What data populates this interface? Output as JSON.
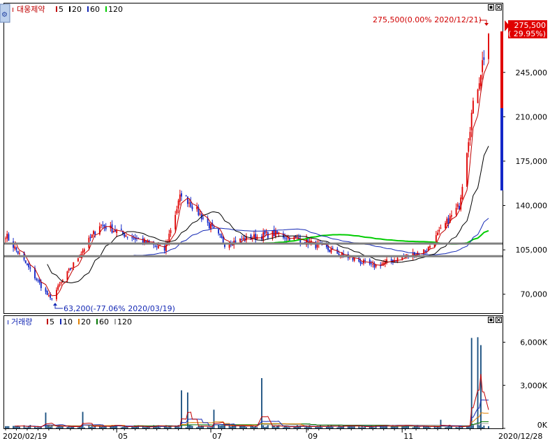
{
  "colors": {
    "up": "#e00000",
    "down": "#1428c8",
    "ma5": "#c00000",
    "ma20": "#000000",
    "ma60": "#1428b4",
    "ma120": "#00cc00",
    "vol_ma5": "#c00000",
    "vol_ma10": "#1428b4",
    "vol_ma20": "#e08000",
    "vol_ma60": "#007700",
    "vol_ma120": "#a0a0a0",
    "hline": "#808080",
    "axis": "#000000"
  },
  "price_panel": {
    "corner_icon": "chart-settings-icon",
    "stock_name": "대웅제약",
    "legend": [
      {
        "label": "5",
        "color": "#c00000"
      },
      {
        "label": "20",
        "color": "#000000"
      },
      {
        "label": "60",
        "color": "#1428b4"
      },
      {
        "label": "120",
        "color": "#00cc00"
      }
    ],
    "high_annotation": "275,500(0.00% 2020/12/21)",
    "low_annotation": "63,200(-77.06% 2020/03/19)",
    "last_price_tag": "275,500",
    "last_change_tag": "( 29.95%)"
  },
  "volume_panel": {
    "title": "거래량",
    "legend": [
      {
        "label": "5",
        "color": "#c00000"
      },
      {
        "label": "10",
        "color": "#1428b4"
      },
      {
        "label": "20",
        "color": "#e08000"
      },
      {
        "label": "60",
        "color": "#007700"
      },
      {
        "label": "120",
        "color": "#a0a0a0"
      }
    ]
  },
  "x_axis": {
    "start_label": "2020/02/19",
    "end_label": "2020/12/28",
    "month_labels": [
      "05",
      "07",
      "09",
      "11"
    ]
  },
  "chart_data": [
    {
      "type": "candlestick",
      "title": "대웅제약",
      "x_range": [
        "2020/02/19",
        "2020/12/28"
      ],
      "y_ticks": [
        70000,
        105000,
        140000,
        175000,
        210000,
        245000
      ],
      "y_tick_labels": [
        "70,000",
        "105,000",
        "140,000",
        "175,000",
        "210,000",
        "245,000"
      ],
      "ylim": [
        55000,
        290000
      ],
      "price_anchor_points": [
        {
          "date": "2020/02/19",
          "close": 117000
        },
        {
          "date": "2020/03/19",
          "close": 66000
        },
        {
          "date": "2020/04/20",
          "close": 125000
        },
        {
          "date": "2020/06/01",
          "close": 105000
        },
        {
          "date": "2020/06/12",
          "close": 150000
        },
        {
          "date": "2020/07/10",
          "close": 110000
        },
        {
          "date": "2020/08/10",
          "close": 118000
        },
        {
          "date": "2020/08/31",
          "close": 112000
        },
        {
          "date": "2020/10/14",
          "close": 92000
        },
        {
          "date": "2020/11/18",
          "close": 105000
        },
        {
          "date": "2020/12/09",
          "close": 140000
        },
        {
          "date": "2020/12/17",
          "close": 212000
        },
        {
          "date": "2020/12/28",
          "close": 275500
        }
      ],
      "highest": {
        "price": 275500,
        "change": "0.00%",
        "date": "2020/12/21"
      },
      "lowest": {
        "price": 63200,
        "change": "-77.06%",
        "date": "2020/03/19"
      },
      "last": {
        "price": 275500,
        "change": "29.95%"
      },
      "horizontal_lines": [
        110000,
        100000
      ],
      "moving_averages": [
        "5",
        "20",
        "60",
        "120"
      ]
    },
    {
      "type": "bar",
      "title": "거래량",
      "y_ticks": [
        0,
        3000,
        6000
      ],
      "y_tick_labels": [
        "0K",
        "3,000K",
        "6,000K"
      ],
      "ylim": [
        0,
        7000
      ],
      "volume_spikes_k": [
        {
          "date": "2020/03/16",
          "value": 1100
        },
        {
          "date": "2020/04/09",
          "value": 1150
        },
        {
          "date": "2020/06/12",
          "value": 2650
        },
        {
          "date": "2020/06/16",
          "value": 2500
        },
        {
          "date": "2020/07/03",
          "value": 1300
        },
        {
          "date": "2020/08/03",
          "value": 3500
        },
        {
          "date": "2020/11/27",
          "value": 600
        },
        {
          "date": "2020/12/17",
          "value": 6300
        },
        {
          "date": "2020/12/21",
          "value": 6350
        },
        {
          "date": "2020/12/23",
          "value": 5800
        }
      ],
      "moving_averages": [
        "5",
        "10",
        "20",
        "60",
        "120"
      ]
    }
  ]
}
